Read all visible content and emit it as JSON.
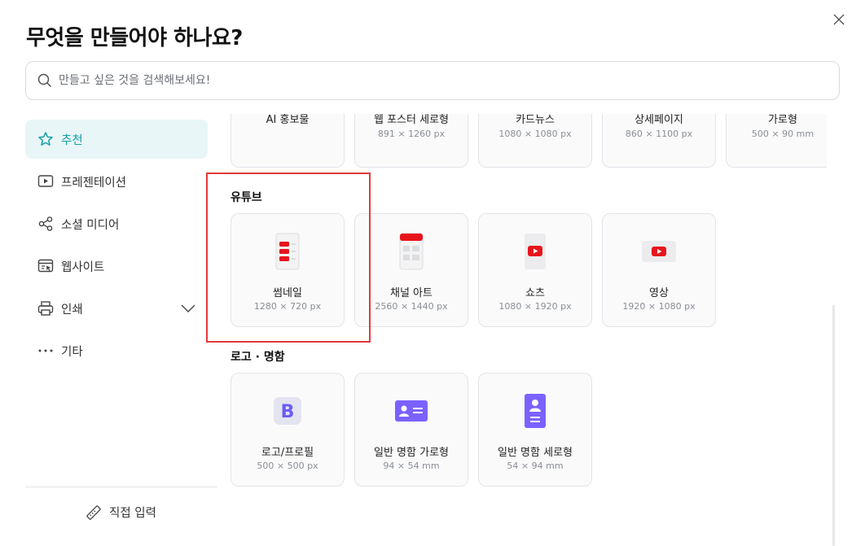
{
  "dialog": {
    "title": "무엇을 만들어야 하나요?",
    "search_placeholder": "만들고 싶은 것을 검색해보세요!"
  },
  "sidebar": {
    "items": [
      {
        "label": "추천",
        "icon": "star-icon",
        "active": true
      },
      {
        "label": "프레젠테이션",
        "icon": "presentation-play-icon"
      },
      {
        "label": "소셜 미디어",
        "icon": "share-icon"
      },
      {
        "label": "웹사이트",
        "icon": "website-icon"
      },
      {
        "label": "인쇄",
        "icon": "printer-icon",
        "expandable": true
      },
      {
        "label": "기타",
        "icon": "more-dots-icon"
      }
    ],
    "direct_input": "직접 입력"
  },
  "top_row": [
    {
      "name": "AI 홍보물",
      "size": ""
    },
    {
      "name": "웹 포스터 세로형",
      "size": "891 × 1260 px"
    },
    {
      "name": "카드뉴스",
      "size": "1080 × 1080 px"
    },
    {
      "name": "상세페이지",
      "size": "860 × 1100 px"
    },
    {
      "name": "가로형",
      "size": "500 × 90 mm"
    }
  ],
  "youtube": {
    "title": "유튜브",
    "cards": [
      {
        "name": "썸네일",
        "size": "1280 × 720 px",
        "icon": "thumbnail-icon"
      },
      {
        "name": "채널 아트",
        "size": "2560 × 1440 px",
        "icon": "channel-art-icon"
      },
      {
        "name": "쇼츠",
        "size": "1080 × 1920 px",
        "icon": "shorts-icon"
      },
      {
        "name": "영상",
        "size": "1920 × 1080 px",
        "icon": "video-icon"
      }
    ]
  },
  "logo": {
    "title": "로고 · 명함",
    "cards": [
      {
        "name": "로고/프로필",
        "size": "500 × 500 px",
        "icon": "logo-b-icon"
      },
      {
        "name": "일반 명함 가로형",
        "size": "94 × 54 mm",
        "icon": "business-card-horizontal-icon"
      },
      {
        "name": "일반 명함 세로형",
        "size": "54 × 94 mm",
        "icon": "business-card-vertical-icon"
      }
    ]
  },
  "colors": {
    "accent": "#17a0a8",
    "active_bg": "#e8f6f7",
    "youtube_red": "#e8141c",
    "card_purple": "#7b61ff",
    "highlight": "#e23a3a"
  }
}
